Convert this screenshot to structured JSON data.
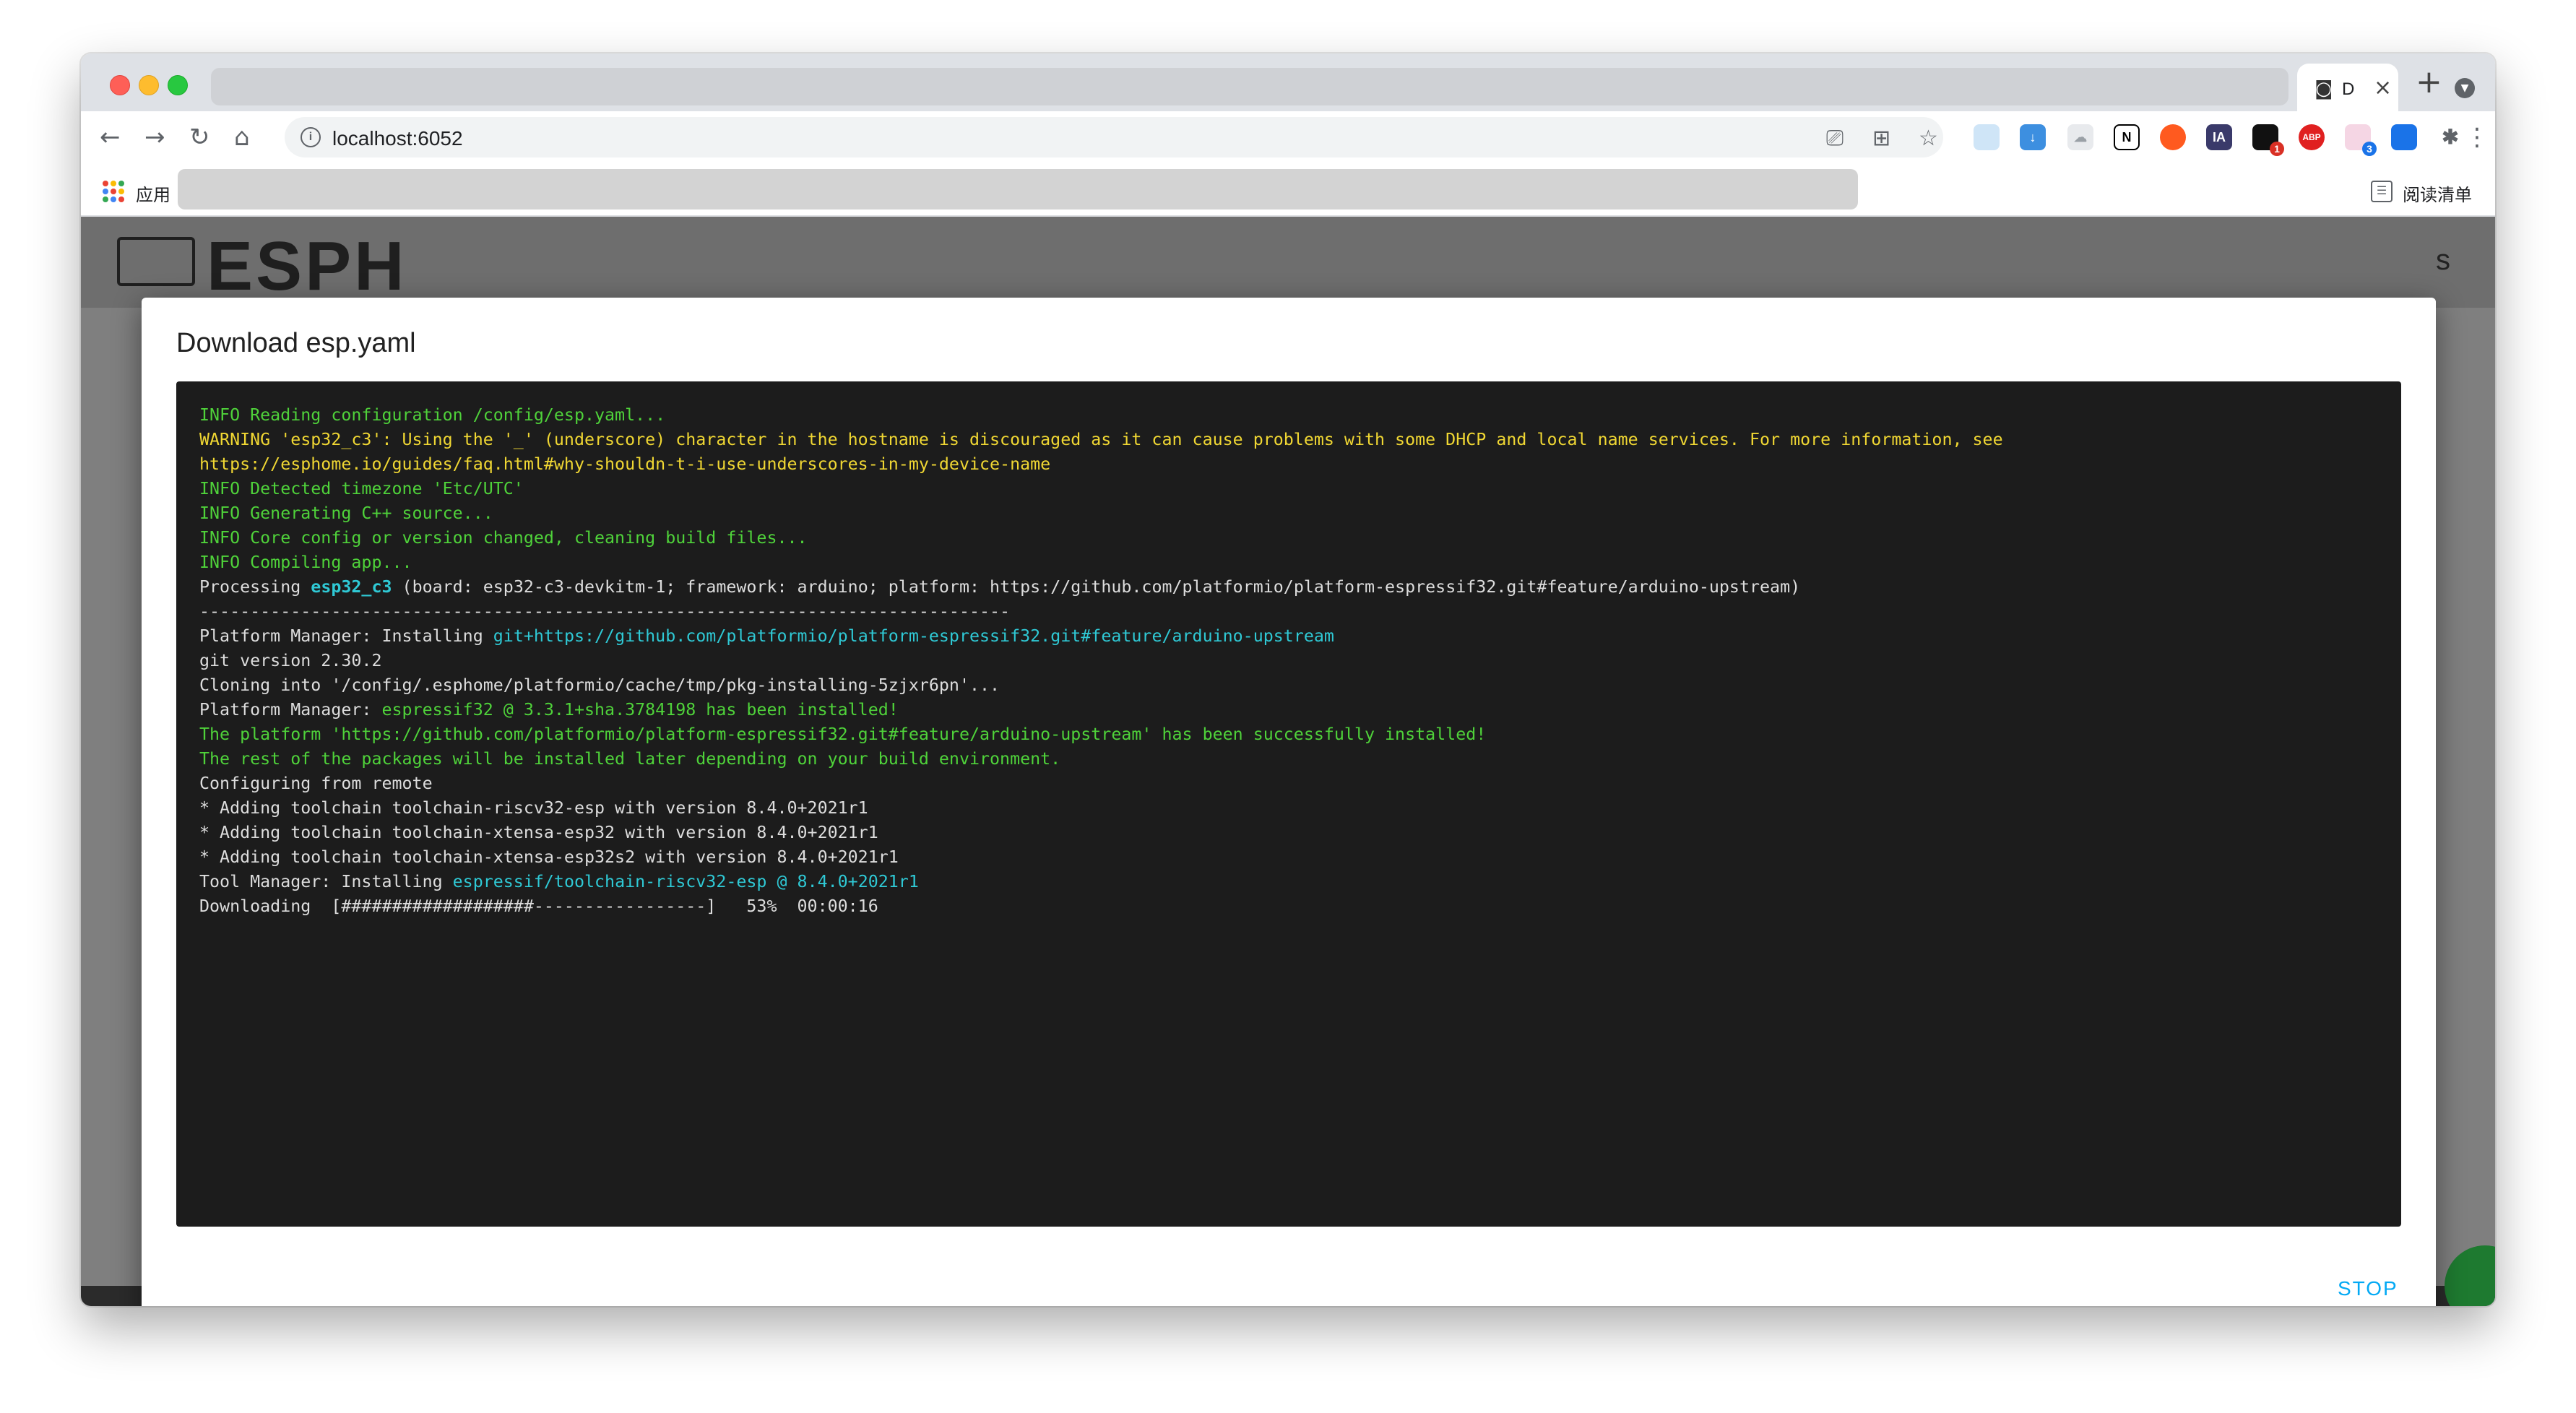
{
  "browser": {
    "tab_title": "D",
    "new_tab_label": "+",
    "url": "localhost:6052",
    "apps_label": "应用",
    "reading_list_label": "阅读清单",
    "extensions": [
      {
        "name": "ext-1",
        "label": "",
        "badge": ""
      },
      {
        "name": "ext-download",
        "label": "",
        "badge": ""
      },
      {
        "name": "ext-cloud",
        "label": "",
        "badge": ""
      },
      {
        "name": "ext-notion",
        "label": "N",
        "badge": ""
      },
      {
        "name": "ext-orange",
        "label": "",
        "badge": ""
      },
      {
        "name": "ext-ia",
        "label": "IA",
        "badge": ""
      },
      {
        "name": "ext-black",
        "label": "",
        "badge": "1"
      },
      {
        "name": "ext-abp",
        "label": "ABP",
        "badge": ""
      },
      {
        "name": "ext-cat",
        "label": "",
        "badge": "3"
      },
      {
        "name": "ext-blue",
        "label": "",
        "badge": ""
      }
    ]
  },
  "app": {
    "logo_text": "ESPH",
    "header_right_text": "s"
  },
  "dialog": {
    "title": "Download esp.yaml",
    "stop_label": "STOP",
    "log_lines": [
      [
        {
          "t": "INFO Reading configuration /config/esp.yaml...",
          "c": "green"
        }
      ],
      [
        {
          "t": "WARNING 'esp32_c3': Using the '_' (underscore) character in the hostname is discouraged as it can cause problems with some DHCP and local name services. For more information, see",
          "c": "yellow"
        }
      ],
      [
        {
          "t": "https://esphome.io/guides/faq.html#why-shouldn-t-i-use-underscores-in-my-device-name",
          "c": "yellow"
        }
      ],
      [
        {
          "t": "INFO Detected timezone 'Etc/UTC'",
          "c": "green"
        }
      ],
      [
        {
          "t": "INFO Generating C++ source...",
          "c": "green"
        }
      ],
      [
        {
          "t": "INFO Core config or version changed, cleaning build files...",
          "c": "green"
        }
      ],
      [
        {
          "t": "INFO Compiling app...",
          "c": "green"
        }
      ],
      [
        {
          "t": "Processing ",
          "c": "white"
        },
        {
          "t": "esp32_c3",
          "c": "bold"
        },
        {
          "t": " (board: esp32-c3-devkitm-1; framework: arduino; platform: https://github.com/platformio/platform-espressif32.git#feature/arduino-upstream)",
          "c": "white"
        }
      ],
      [
        {
          "t": "--------------------------------------------------------------------------------",
          "c": "white"
        }
      ],
      [
        {
          "t": "Platform Manager: Installing ",
          "c": "white"
        },
        {
          "t": "git+https://github.com/platformio/platform-espressif32.git#feature/arduino-upstream",
          "c": "cyan"
        }
      ],
      [
        {
          "t": "git version 2.30.2",
          "c": "white"
        }
      ],
      [
        {
          "t": "Cloning into '/config/.esphome/platformio/cache/tmp/pkg-installing-5zjxr6pn'...",
          "c": "white"
        }
      ],
      [
        {
          "t": "Platform Manager: ",
          "c": "white"
        },
        {
          "t": "espressif32 @ 3.3.1+sha.3784198 has been installed!",
          "c": "green"
        }
      ],
      [
        {
          "t": "The platform 'https://github.com/platformio/platform-espressif32.git#feature/arduino-upstream' has been successfully installed!",
          "c": "green"
        }
      ],
      [
        {
          "t": "The rest of the packages will be installed later depending on your build environment.",
          "c": "green"
        }
      ],
      [
        {
          "t": "Configuring from remote",
          "c": "white"
        }
      ],
      [
        {
          "t": "* Adding toolchain toolchain-riscv32-esp with version 8.4.0+2021r1",
          "c": "white"
        }
      ],
      [
        {
          "t": "* Adding toolchain toolchain-xtensa-esp32 with version 8.4.0+2021r1",
          "c": "white"
        }
      ],
      [
        {
          "t": "* Adding toolchain toolchain-xtensa-esp32s2 with version 8.4.0+2021r1",
          "c": "white"
        }
      ],
      [
        {
          "t": "Tool Manager: Installing ",
          "c": "white"
        },
        {
          "t": "espressif/toolchain-riscv32-esp @ 8.4.0+2021r1",
          "c": "cyan"
        }
      ],
      [
        {
          "t": "Downloading  [###################-----------------]   53%  00:00:16",
          "c": "white"
        }
      ]
    ]
  },
  "colors": {
    "console_bg": "#1c1c1c",
    "log_green": "#4fd23a",
    "log_yellow": "#f0d733",
    "log_cyan": "#2fc9d5",
    "stop_accent": "#03a9f4"
  }
}
